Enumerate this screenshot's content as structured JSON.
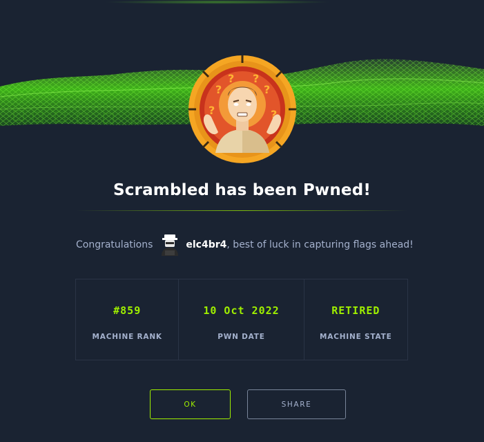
{
  "title": "Scrambled has been Pwned!",
  "congrats": {
    "label": "Congratulations",
    "username": "elc4br4",
    "message": ", best of luck in capturing flags ahead!"
  },
  "stats": [
    {
      "value": "#859",
      "caption": "MACHINE RANK"
    },
    {
      "value": "10 Oct 2022",
      "caption": "PWN DATE"
    },
    {
      "value": "RETIRED",
      "caption": "MACHINE STATE"
    }
  ],
  "buttons": {
    "ok": "OK",
    "share": "SHARE"
  },
  "colors": {
    "background": "#1a2332",
    "accent": "#9fef00",
    "muted_text": "#a4b1cd",
    "badge_ring": "#f5a623"
  },
  "icons": {
    "badge": "machine-avatar-icon",
    "user": "user-avatar-icon"
  }
}
